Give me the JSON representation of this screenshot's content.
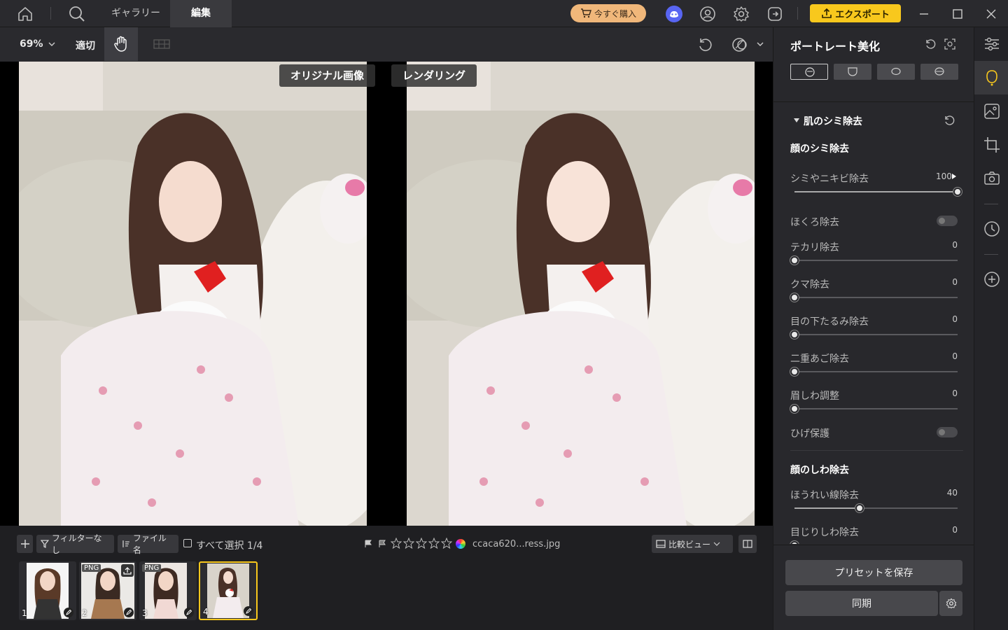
{
  "titlebar": {
    "tabs": [
      {
        "label": "ギャラリー"
      },
      {
        "label": "編集"
      }
    ],
    "buy_label": "今すぐ購入",
    "export_label": "エクスポート"
  },
  "toolbar": {
    "zoom": "69%",
    "fit_label": "適切"
  },
  "compare": {
    "original_label": "オリジナル画像",
    "rendered_label": "レンダリング"
  },
  "bottombar": {
    "filter_label": "フィルターなし",
    "sort_label": "ファイル名",
    "select_all_label": "すべて選択 1/4",
    "filename": "ccaca620...ress.jpg",
    "view_label": "比較ビュー",
    "thumbnails": [
      {
        "num": "1",
        "badge": ""
      },
      {
        "num": "2",
        "badge": "PNG"
      },
      {
        "num": "3",
        "badge": "PNG"
      },
      {
        "num": "4",
        "badge": ""
      }
    ]
  },
  "panel": {
    "title": "ポートレート美化",
    "section_title": "肌のシミ除去",
    "group1_title": "顔のシミ除去",
    "sliders": [
      {
        "label": "シミやニキビ除去",
        "value": "100",
        "level": 1.0
      },
      {
        "label": "テカリ除去",
        "value": "0",
        "level": 0
      },
      {
        "label": "クマ除去",
        "value": "0",
        "level": 0
      },
      {
        "label": "目の下たるみ除去",
        "value": "0",
        "level": 0
      },
      {
        "label": "二重あご除去",
        "value": "0",
        "level": 0
      },
      {
        "label": "眉しわ調整",
        "value": "0",
        "level": 0
      }
    ],
    "toggles": [
      {
        "label": "ほくろ除去"
      },
      {
        "label": "ひげ保護"
      }
    ],
    "group2_title": "顔のしわ除去",
    "sliders2": [
      {
        "label": "ほうれい線除去",
        "value": "40",
        "level": 0.4
      },
      {
        "label": "目じりしわ除去",
        "value": "0",
        "level": 0
      }
    ],
    "save_preset_label": "プリセットを保存",
    "sync_label": "同期"
  },
  "colors": {
    "accent": "#f8c81d",
    "buy": "#f0b77a",
    "discord": "#5865f2"
  }
}
